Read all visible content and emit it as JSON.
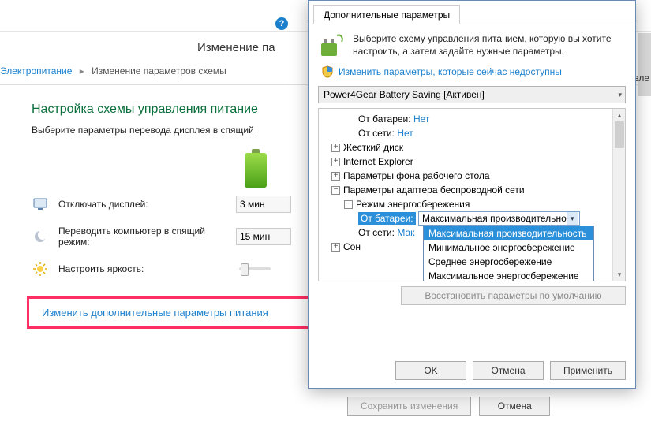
{
  "back": {
    "title": "Изменение па",
    "breadcrumb": {
      "root": "Электропитание",
      "current": "Изменение параметров схемы"
    },
    "section_title": "Настройка схемы управления питание",
    "section_sub": "Выберите параметры перевода дисплея в спящий",
    "rows": {
      "display_off_label": "Отключать дисплей:",
      "display_off_value": "3 мин",
      "sleep_label": "Переводить компьютер в спящий режим:",
      "sleep_value": "15 мин",
      "brightness_label": "Настроить яркость:"
    },
    "adv_link": "Изменить дополнительные параметры питания",
    "buttons": {
      "save": "Сохранить изменения",
      "cancel": "Отмена"
    }
  },
  "dialog": {
    "tab": "Дополнительные параметры",
    "intro": "Выберите схему управления питанием, которую вы хотите настроить, а затем задайте нужные параметры.",
    "uac_link": "Изменить параметры, которые сейчас недоступны",
    "plan": "Power4Gear Battery Saving [Активен]",
    "tree": {
      "on_battery_label": "От батареи:",
      "on_battery_value": "Нет",
      "on_ac_label": "От сети:",
      "on_ac_value": "Нет",
      "hdd": "Жесткий диск",
      "ie": "Internet Explorer",
      "desktop_bg": "Параметры фона рабочего стола",
      "wlan": "Параметры адаптера беспроводной сети",
      "wlan_mode": "Режим энергосбережения",
      "wlan_on_battery_label": "От батареи:",
      "wlan_on_battery_value": "Максимальная производительно",
      "wlan_on_ac_label": "От сети:",
      "wlan_on_ac_value": "Мак",
      "sleep_node": "Сон"
    },
    "dropdown": {
      "opt1": "Максимальная производительность",
      "opt2": "Минимальное энергосбережение",
      "opt3": "Среднее энергосбережение",
      "opt4": "Максимальное энергосбережение"
    },
    "restore": "Восстановить параметры по умолчанию",
    "buttons": {
      "ok": "OK",
      "cancel": "Отмена",
      "apply": "Применить"
    }
  },
  "misc": {
    "tab_fragment": "вле"
  }
}
